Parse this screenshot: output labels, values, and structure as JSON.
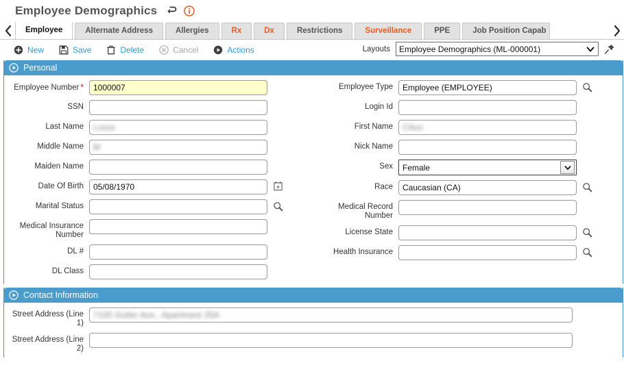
{
  "window": {
    "title": "Employee Demographics",
    "return_icon": "return-arrow-icon",
    "info_icon": "info-circle-icon"
  },
  "tabs": {
    "prev_label": "‹",
    "next_label": "›",
    "items": [
      {
        "label": "Employee",
        "active": true,
        "alert": false
      },
      {
        "label": "Alternate Address",
        "active": false,
        "alert": false
      },
      {
        "label": "Allergies",
        "active": false,
        "alert": false
      },
      {
        "label": "Rx",
        "active": false,
        "alert": true
      },
      {
        "label": "Dx",
        "active": false,
        "alert": true
      },
      {
        "label": "Restrictions",
        "active": false,
        "alert": false
      },
      {
        "label": "Surveillance",
        "active": false,
        "alert": true
      },
      {
        "label": "PPE",
        "active": false,
        "alert": false
      },
      {
        "label": "Job Position Capab",
        "active": false,
        "alert": false
      }
    ]
  },
  "toolbar": {
    "new_label": "New",
    "save_label": "Save",
    "delete_label": "Delete",
    "cancel_label": "Cancel",
    "actions_label": "Actions",
    "layouts_label": "Layouts",
    "layout_selected": "Employee Demographics (ML-000001)",
    "pin_icon": "pushpin-icon"
  },
  "personal": {
    "section_title": "Personal",
    "left": [
      {
        "label": "Employee Number",
        "required": true,
        "value": "1000007",
        "highlight": true,
        "adornment": "none",
        "blurred": false
      },
      {
        "label": "SSN",
        "required": false,
        "value": "",
        "highlight": false,
        "adornment": "none",
        "blurred": false
      },
      {
        "label": "Last Name",
        "required": false,
        "value": "Lxxxx",
        "highlight": false,
        "adornment": "none",
        "blurred": true
      },
      {
        "label": "Middle Name",
        "required": false,
        "value": "M",
        "highlight": false,
        "adornment": "none",
        "blurred": true
      },
      {
        "label": "Maiden Name",
        "required": false,
        "value": "",
        "highlight": false,
        "adornment": "none",
        "blurred": false
      },
      {
        "label": "Date Of Birth",
        "required": false,
        "value": "05/08/1970",
        "highlight": false,
        "adornment": "calendar",
        "blurred": false
      },
      {
        "label": "Marital Status",
        "required": false,
        "value": "",
        "highlight": false,
        "adornment": "search",
        "blurred": false
      },
      {
        "label": "Medical Insurance Number",
        "required": false,
        "value": "",
        "highlight": false,
        "adornment": "none",
        "blurred": false
      },
      {
        "label": "DL #",
        "required": false,
        "value": "",
        "highlight": false,
        "adornment": "none",
        "blurred": false
      },
      {
        "label": "DL Class",
        "required": false,
        "value": "",
        "highlight": false,
        "adornment": "none",
        "blurred": false
      }
    ],
    "right": [
      {
        "label": "Employee Type",
        "required": false,
        "value": "Employee (EMPLOYEE)",
        "highlight": false,
        "adornment": "search",
        "blurred": false,
        "control": "text"
      },
      {
        "label": "Login Id",
        "required": false,
        "value": "",
        "highlight": false,
        "adornment": "none",
        "blurred": false,
        "control": "text"
      },
      {
        "label": "First Name",
        "required": false,
        "value": "CAxx",
        "highlight": false,
        "adornment": "none",
        "blurred": true,
        "control": "text"
      },
      {
        "label": "Nick Name",
        "required": false,
        "value": "",
        "highlight": false,
        "adornment": "none",
        "blurred": false,
        "control": "text"
      },
      {
        "label": "Sex",
        "required": false,
        "value": "Female",
        "highlight": false,
        "adornment": "none",
        "blurred": false,
        "control": "select"
      },
      {
        "label": "Race",
        "required": false,
        "value": "Caucasian (CA)",
        "highlight": false,
        "adornment": "search",
        "blurred": false,
        "control": "text"
      },
      {
        "label": "Medical Record Number",
        "required": false,
        "value": "",
        "highlight": false,
        "adornment": "none",
        "blurred": false,
        "control": "text"
      },
      {
        "label": "License State",
        "required": false,
        "value": "",
        "highlight": false,
        "adornment": "search",
        "blurred": false,
        "control": "text"
      },
      {
        "label": "Health Insurance",
        "required": false,
        "value": "",
        "highlight": false,
        "adornment": "search",
        "blurred": false,
        "control": "text"
      }
    ]
  },
  "contact": {
    "section_title": "Contact Information",
    "rows": [
      {
        "label": "Street Address (Line 1)",
        "value": "7100 Sutter Ave., Apartment 25A",
        "blurred": true
      },
      {
        "label": "Street Address (Line 2)",
        "value": "",
        "blurred": false
      }
    ]
  },
  "colors": {
    "accent_blue": "#4a9ccc",
    "link_blue": "#2e9bd6",
    "alert_orange": "#ee5a24",
    "required_red": "#dd1111",
    "highlight_yellow": "#ffffcc"
  }
}
